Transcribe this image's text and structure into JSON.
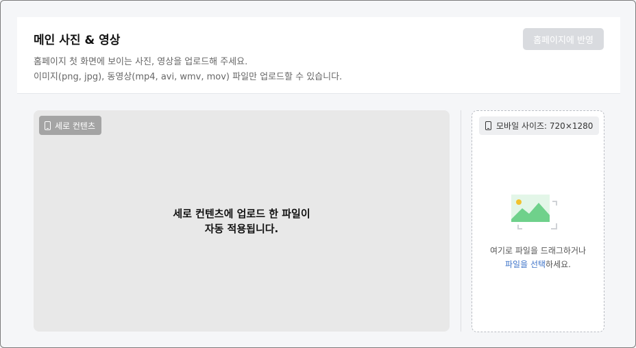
{
  "header": {
    "title": "메인 사진 & 영상",
    "description_line1": "홈페이지 첫 화면에 보이는 사진, 영상을 업로드해 주세요.",
    "description_line2": "이미지(png, jpg), 동영상(mp4, avi, wmv, mov) 파일만 업로드할 수 있습니다.",
    "apply_button_label": "홈페이지에 반영"
  },
  "preview": {
    "tag_label": "세로 컨텐츠",
    "tag_icon": "phone-icon",
    "message_line1": "세로 컨텐츠에 업로드 한 파일이",
    "message_line2": "자동 적용됩니다."
  },
  "upload": {
    "size_label": "모바일 사이즈: 720×1280",
    "size_icon": "phone-icon",
    "image_icon": "image-placeholder-icon",
    "drag_text": "여기로 파일을 드래그하거나",
    "select_link": "파일을 선택",
    "select_suffix": "하세요."
  },
  "colors": {
    "link": "#3f74c9",
    "disabled_button": "#d9dbdf",
    "preview_bg": "#e8e8e8",
    "image_icon_green": "#6fd18b",
    "image_icon_sun": "#f2c22e"
  }
}
